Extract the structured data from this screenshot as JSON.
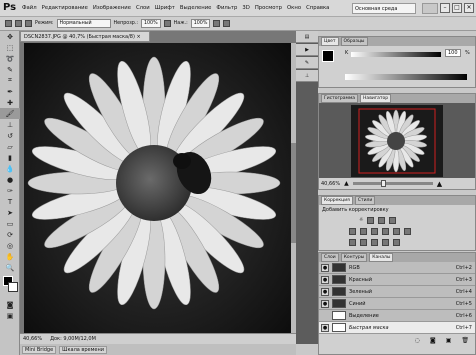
{
  "app": {
    "logo": "Ps"
  },
  "menu": [
    "Файл",
    "Редактирование",
    "Изображение",
    "Слои",
    "Шрифт",
    "Выделение",
    "Фильтр",
    "3D",
    "Просмотр",
    "Окно",
    "Справка"
  ],
  "workspace": {
    "label": "Основная среда"
  },
  "options": {
    "mode_label": "Режим:",
    "mode": "Нормальный",
    "opacity_label": "Непрозр.:",
    "opacity": "100%",
    "pressure_label": "Наж.:",
    "pressure": "100%"
  },
  "document": {
    "tab": "DSCN2837.JPG @ 40,7% (Быстрая маска/8)",
    "zoom": "40,66%",
    "doc_size": "Док: 9,00М/12,0М"
  },
  "minibridge": [
    "Mini Bridge",
    "Шкала времени"
  ],
  "color_panel": {
    "tabs": [
      "Цвет",
      "Образцы"
    ],
    "channel": "K",
    "value": "100",
    "unit": "%"
  },
  "navigator": {
    "tabs": [
      "Гистограмма",
      "Навигатор"
    ],
    "zoom": "40,66%"
  },
  "adjustments": {
    "tabs": [
      "Коррекция",
      "Стили"
    ],
    "title": "Добавить корректировку"
  },
  "channels": {
    "tabs": [
      "Слои",
      "Контуры",
      "Каналы"
    ],
    "items": [
      {
        "name": "RGB",
        "shortcut": "Ctrl+2"
      },
      {
        "name": "Красный",
        "shortcut": "Ctrl+3"
      },
      {
        "name": "Зеленый",
        "shortcut": "Ctrl+4"
      },
      {
        "name": "Синий",
        "shortcut": "Ctrl+5"
      },
      {
        "name": "Выделение",
        "shortcut": "Ctrl+6"
      },
      {
        "name": "Быстрая маска",
        "shortcut": "Ctrl+7"
      }
    ]
  }
}
